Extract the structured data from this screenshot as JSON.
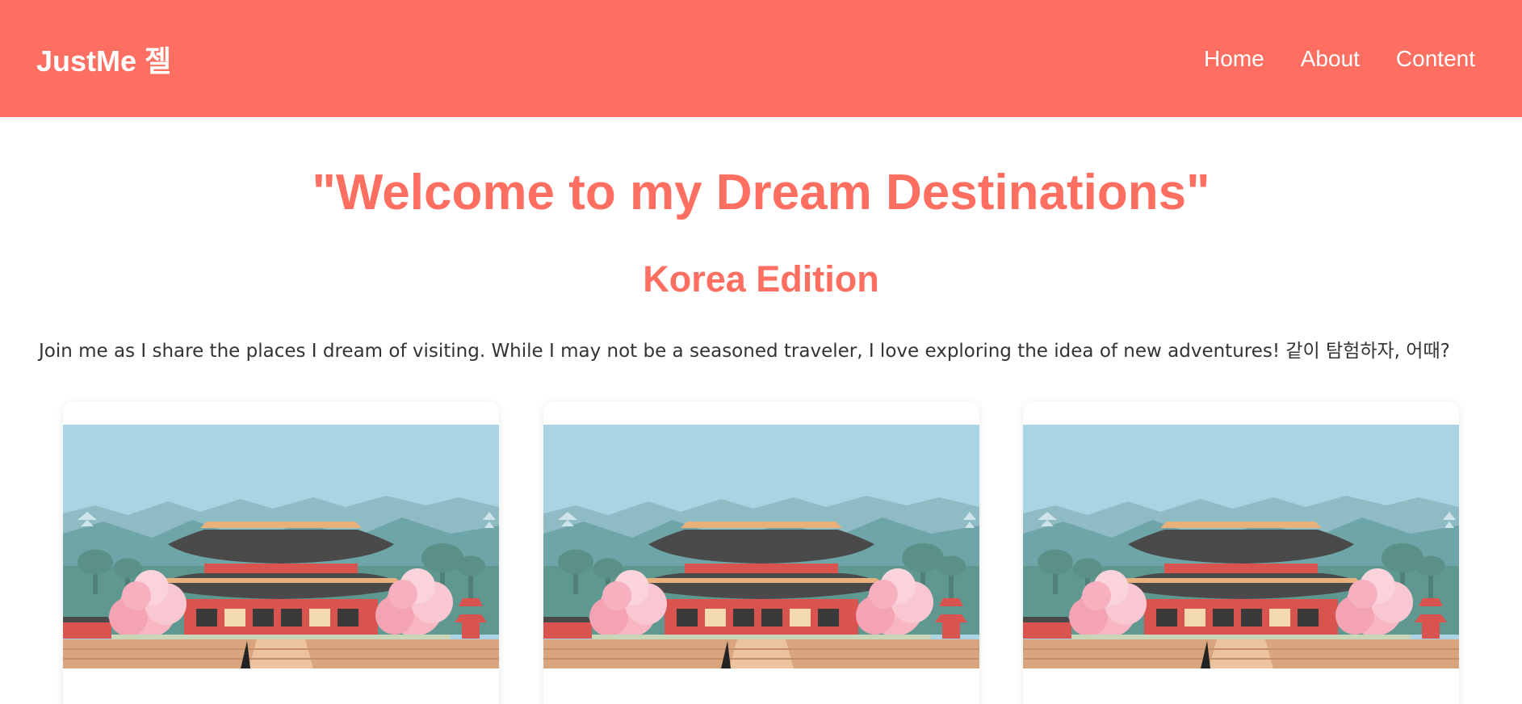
{
  "header": {
    "brand": "JustMe 젤",
    "nav": [
      "Home",
      "About",
      "Content"
    ]
  },
  "hero": {
    "title": "\"Welcome to my Dream Destinations\"",
    "subtitle": "Korea Edition",
    "intro": "Join me as I share the places I dream of visiting. While I may not be a seasoned traveler, I love exploring the idea of new adventures! 같이 탐험하자, 어때?"
  },
  "cards": [
    {
      "image_icon": "korean-palace-illustration"
    },
    {
      "image_icon": "korean-palace-illustration"
    },
    {
      "image_icon": "korean-palace-illustration"
    }
  ],
  "colors": {
    "accent": "#ff6f61",
    "sky": "#aad3e4",
    "mountain_far": "#8fbcc4",
    "mountain_near": "#6ea5a8",
    "roof": "#4a4a4a",
    "palace_red": "#d9534f",
    "blossom": "#f7b6c2",
    "ground": "#d9a57f"
  }
}
